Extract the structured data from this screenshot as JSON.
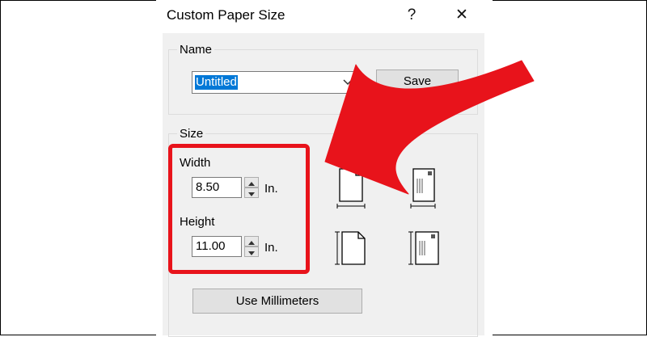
{
  "dialog": {
    "title": "Custom Paper Size",
    "help_symbol": "?",
    "close_symbol": "✕"
  },
  "name_group": {
    "label": "Name",
    "value": "Untitled",
    "save_label": "Save"
  },
  "size_group": {
    "label": "Size",
    "width_label": "Width",
    "width_value": "8.50",
    "width_unit": "In.",
    "height_label": "Height",
    "height_value": "11.00",
    "height_unit": "In.",
    "use_mm_label": "Use Millimeters"
  },
  "colors": {
    "highlight": "#e8131b",
    "selection": "#0078d7"
  },
  "icons": [
    "portrait-width-icon",
    "landscape-envelope-width-icon",
    "portrait-height-icon",
    "landscape-envelope-height-icon"
  ]
}
